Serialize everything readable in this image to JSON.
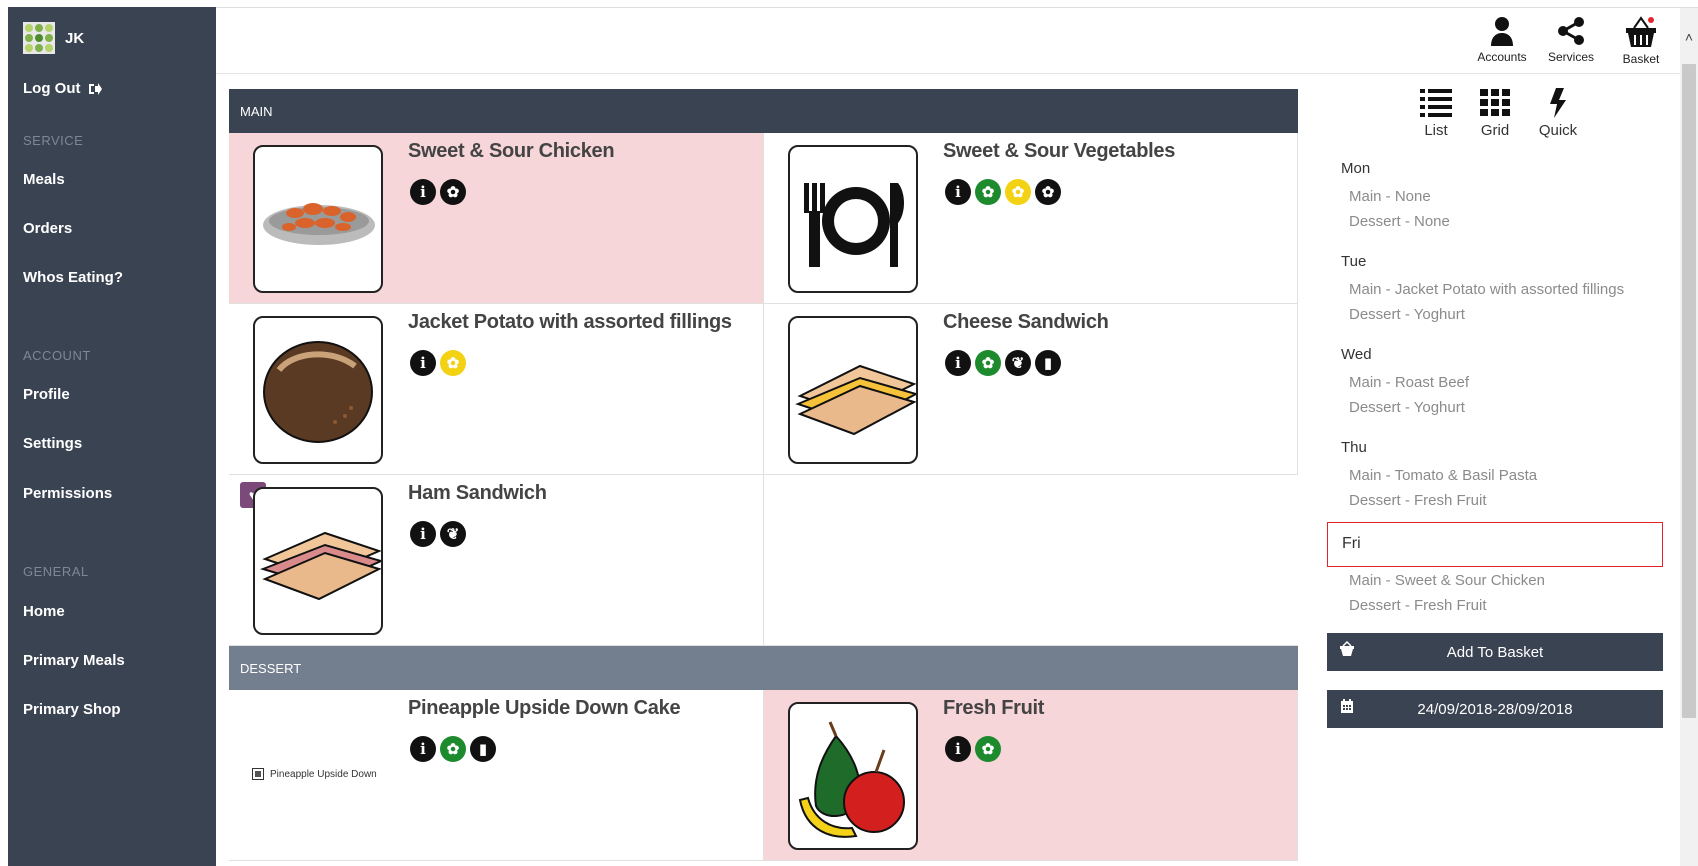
{
  "user": {
    "initials": "JK",
    "logout_label": "Log Out"
  },
  "sidebar": {
    "sections": [
      {
        "heading": "SERVICE",
        "items": [
          "Meals",
          "Orders",
          "Whos Eating?"
        ]
      },
      {
        "heading": "ACCOUNT",
        "items": [
          "Profile",
          "Settings",
          "Permissions"
        ]
      },
      {
        "heading": "GENERAL",
        "items": [
          "Home",
          "Primary Meals",
          "Primary Shop"
        ]
      }
    ]
  },
  "topbar": {
    "accounts": "Accounts",
    "services": "Services",
    "basket": "Basket"
  },
  "views": {
    "list": "List",
    "grid": "Grid",
    "quick": "Quick"
  },
  "menu": {
    "main_heading": "MAIN",
    "dessert_heading": "DESSERT",
    "main_items": [
      {
        "title": "Sweet & Sour Chicken",
        "badges": [
          "info",
          "allergen"
        ]
      },
      {
        "title": "Sweet & Sour Vegetables",
        "badges": [
          "info",
          "vegetarian",
          "vegan",
          "allergen"
        ]
      },
      {
        "title": "Jacket Potato with assorted fillings",
        "badges": [
          "info",
          "vegan"
        ]
      },
      {
        "title": "Cheese Sandwich",
        "badges": [
          "info",
          "vegetarian",
          "gluten",
          "dairy"
        ]
      },
      {
        "title": "Ham Sandwich",
        "badges": [
          "info",
          "gluten"
        ]
      }
    ],
    "dessert_items": [
      {
        "title": "Pineapple Upside Down Cake",
        "badges": [
          "info",
          "vegetarian",
          "dairy"
        ],
        "alt_text": "Pineapple Upside Down"
      },
      {
        "title": "Fresh Fruit",
        "badges": [
          "info",
          "vegetarian"
        ]
      }
    ]
  },
  "schedule": {
    "days": [
      {
        "day": "Mon",
        "main": "Main - None",
        "dessert": "Dessert - None"
      },
      {
        "day": "Tue",
        "main": "Main - Jacket Potato with assorted fillings",
        "dessert": "Dessert - Yoghurt"
      },
      {
        "day": "Wed",
        "main": "Main - Roast Beef",
        "dessert": "Dessert - Yoghurt"
      },
      {
        "day": "Thu",
        "main": "Main - Tomato & Basil Pasta",
        "dessert": "Dessert - Fresh Fruit"
      },
      {
        "day": "Fri",
        "main": "Main - Sweet & Sour Chicken",
        "dessert": "Dessert - Fresh Fruit"
      }
    ],
    "selected_day": "Fri",
    "add_to_basket": "Add To Basket",
    "date_range": "24/09/2018-28/09/2018"
  },
  "colors": {
    "sidebar": "#3a4352",
    "pink_card": "#f7d6da",
    "selected_border": "#e2252b",
    "green_badge": "#1d8a2e",
    "yellow_badge": "#f2d213"
  }
}
